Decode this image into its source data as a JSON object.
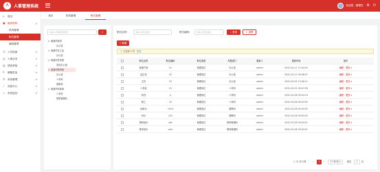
{
  "app": {
    "title": "人事管理系统",
    "logo_text": "人"
  },
  "user": {
    "greeting": "欢迎您，管理员",
    "icons": [
      "gear-icon",
      "power-icon"
    ]
  },
  "colors": {
    "accent": "#d6302b",
    "sidebar_bg": "#ffffff",
    "content_bg": "#f2f3f5"
  },
  "sidebar": {
    "items": [
      {
        "label": "首页",
        "icon": "home-icon"
      },
      {
        "label": "组织机构",
        "icon": "org-icon",
        "open": true,
        "children": [
          {
            "label": "机构管理"
          },
          {
            "label": "职位管理",
            "active": true
          },
          {
            "label": "编制管理"
          }
        ]
      },
      {
        "label": "人员档案",
        "icon": "person-icon"
      },
      {
        "label": "人事业务",
        "icon": "briefcase-icon"
      },
      {
        "label": "绩效考核",
        "icon": "chart-icon"
      },
      {
        "label": "薪酬发放",
        "icon": "money-icon"
      },
      {
        "label": "系统管理",
        "icon": "gear-icon"
      },
      {
        "label": "消息中心",
        "icon": "bell-icon"
      },
      {
        "label": "系统监控",
        "icon": "monitor-icon"
      }
    ]
  },
  "tabs": [
    {
      "label": "首页"
    },
    {
      "label": "机构管理"
    },
    {
      "label": "职位管理",
      "active": true
    }
  ],
  "tree": {
    "search_placeholder": "请输入机构名称搜索",
    "nodes": [
      {
        "label": "南通市政府",
        "level": 0,
        "expanded": true
      },
      {
        "label": "办公室",
        "level": 1
      },
      {
        "label": "南通市总工会",
        "level": 0,
        "expanded": true
      },
      {
        "label": "办公室",
        "level": 1
      },
      {
        "label": "南通市发改委",
        "level": 0,
        "expanded": true
      },
      {
        "label": "发改办公室",
        "level": 1
      },
      {
        "label": "南通市教育局",
        "level": 0,
        "expanded": true,
        "selected": true
      },
      {
        "label": "办公室",
        "level": 1
      },
      {
        "label": "人事科",
        "level": 1
      },
      {
        "label": "基教科",
        "level": 1
      },
      {
        "label": "南通市财政局",
        "level": 0,
        "expanded": true
      },
      {
        "label": "人事科",
        "level": 1
      },
      {
        "label": "预算管理科",
        "level": 1
      }
    ]
  },
  "filters": {
    "position_name_label": "职位名称:",
    "position_name_placeholder": "请输入职位名称",
    "position_code_label": "职位编码:",
    "position_code_placeholder": "请输入职位编码",
    "search_label": "查询",
    "reset_label": "重置"
  },
  "toolbar": {
    "add_label": "+ 新增"
  },
  "selection": {
    "text": "已选择 0 项",
    "clear_label": "清空"
  },
  "table": {
    "columns": [
      "职位名称",
      "职位编码",
      "职位类型",
      "所属部门",
      "更新人",
      "更新时间",
      "操作"
    ],
    "rows": [
      [
        "普通干部",
        "01",
        "管理岗位",
        "办公室",
        "admin",
        "2022-04-11 11:44:04"
      ],
      [
        "副主任",
        "02",
        "管理岗位",
        "办公室",
        "admin",
        "2022-04-11 09:48:07"
      ],
      [
        "主任",
        "03",
        "管理岗位",
        "办公室",
        "admin",
        "2022-04-09 13:56:11"
      ],
      [
        "人事处",
        "22",
        "管理岗位",
        "人事科",
        "admin",
        "2022-03-31 09:47:09"
      ],
      [
        "科员",
        "a",
        "管理岗位",
        "人事科",
        "admin",
        "2022-04-06 09:04:19"
      ],
      [
        "职工",
        "23",
        "管理岗位",
        "人事科",
        "admin",
        "2022-04-06 09:03:55"
      ],
      [
        "副科长",
        "1024",
        "管理岗位",
        "基教科",
        "admin",
        "2022-04-06 09:04:25"
      ],
      [
        "科长",
        "222",
        "管理岗位",
        "基教科",
        "admin",
        "2022-04-06 09:04:25"
      ],
      [
        "预研部长",
        "aaf",
        "管理岗位",
        "预研管理科",
        "admin",
        "2022-03-28 16:54:21"
      ],
      [
        "董事部长",
        "ae4",
        "管理岗位",
        "预研管理科",
        "admin",
        "2022-03-28 16:54:07"
      ]
    ],
    "actions": {
      "edit": "编辑",
      "more": "更多 ▾"
    }
  },
  "pagination": {
    "total_text": "1-10 共10条",
    "prev": "‹",
    "current_page": "1",
    "next": "›",
    "page_size": "10 条/页 ▾",
    "goto_label": "跳至",
    "goto_value": "1",
    "page_suffix": "页"
  }
}
